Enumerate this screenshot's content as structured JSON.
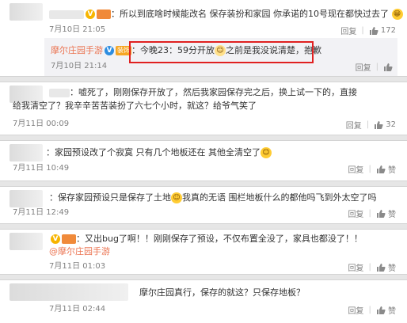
{
  "comments": [
    {
      "text": "：所以到底啥时候能改名 保存装扮和家园 你承诺的10号现在都快过去了",
      "emoji": "😁",
      "date": "7月10日 21:05",
      "reply_label": "回复",
      "like_count": "172",
      "official_reply": {
        "user": "摩尔庄园手游",
        "level_badge": "装饰",
        "text_prefix": "：今晚23：59分开放",
        "text_suffix": "之前是我没说清楚，抱歉",
        "date": "7月10日 21:14",
        "reply_label": "回复",
        "like_count": ""
      }
    },
    {
      "text_line1": "：嘘死了，刚刚保存开放了，然后我家园保存完之后，换上试一下的，直接",
      "text_line2": "给我清空了？我辛辛苦苦装扮了六七个小时，就这？给爷气笑了",
      "date": "7月11日 00:09",
      "reply_label": "回复",
      "like_count": "32"
    },
    {
      "text": "：家园预设改了个寂寞 只有几个地板还在 其他全清空了",
      "date": "7月11日 10:49",
      "reply_label": "回复",
      "like_count": "赞"
    },
    {
      "text_prefix": "：保存家园预设只是保存了土地",
      "text_suffix": "我真的无语 围栏地板什么的都他吗飞到外太空了吗",
      "date": "7月11日 12:49",
      "reply_label": "回复",
      "like_count": "赞"
    },
    {
      "text_line1": "：又出bug了啊！！刚刚保存了预设，不仅布置全没了，家具也都没了！！",
      "mention": "@摩尔庄园手游",
      "date": "7月11日 01:03",
      "reply_label": "回复",
      "like_count": "赞"
    },
    {
      "text": "摩尔庄园真行，保存的就这？只保存地板？",
      "date": "7月11日 02:44",
      "reply_label": "回复",
      "like_count": "赞"
    }
  ],
  "colors": {
    "username": "#eb7350",
    "highlight_box": "#e02020",
    "reply_bg": "#f2f2f5",
    "divider": "#e6e6e6"
  },
  "icons": {
    "like": "thumbs-up-icon",
    "verified": "verified-v-icon",
    "emoji_grin": "grin-emoji-icon",
    "emoji_smile": "smile-emoji-icon"
  }
}
